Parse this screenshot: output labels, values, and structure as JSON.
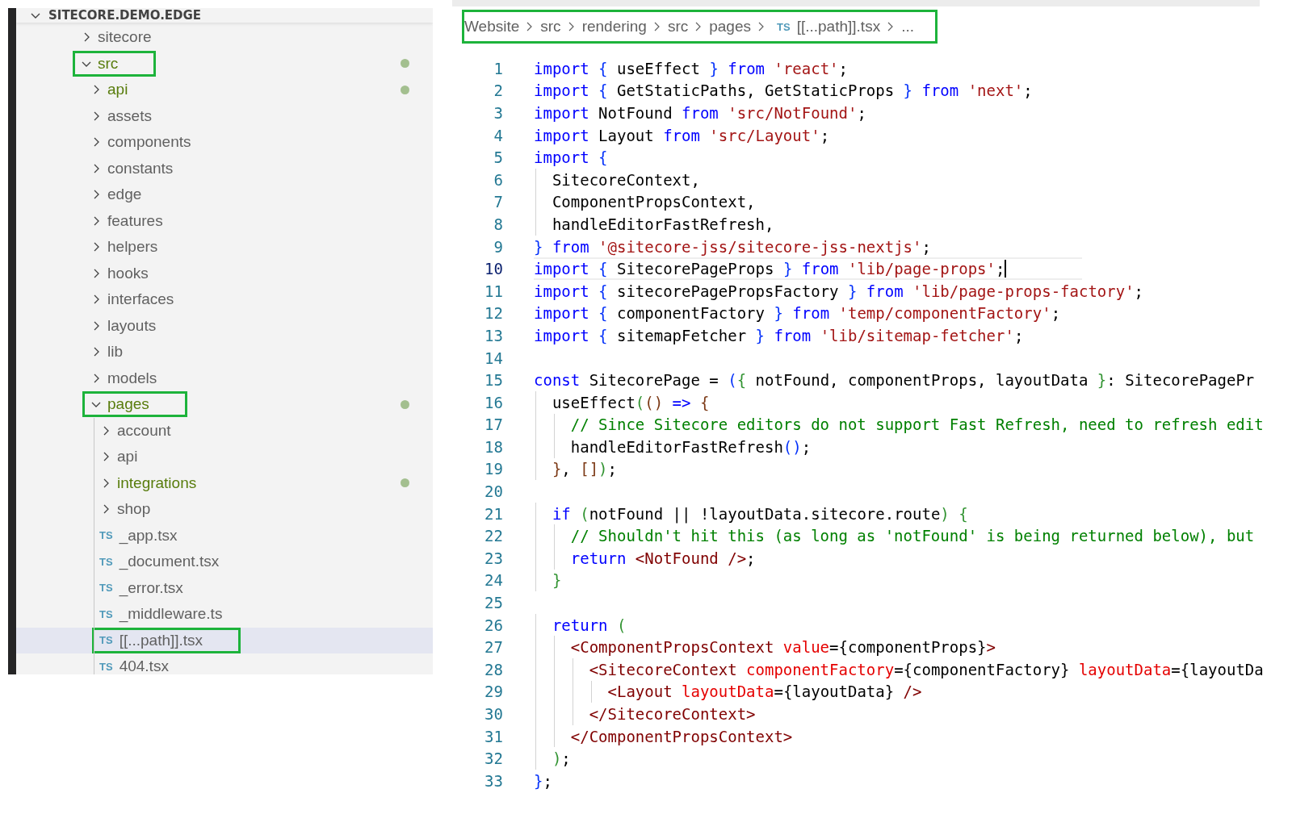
{
  "explorer": {
    "title": "SITECORE.DEMO.EDGE",
    "expanded": true,
    "items": [
      {
        "name": "sitecore",
        "kind": "folder",
        "expanded": false,
        "modified": false,
        "selected": false,
        "highlighted": false
      },
      {
        "name": "src",
        "kind": "folder",
        "expanded": true,
        "modified": true,
        "selected": false,
        "highlighted": true,
        "children": [
          {
            "name": "api",
            "kind": "folder",
            "expanded": false,
            "modified": true,
            "selected": false,
            "highlighted": false
          },
          {
            "name": "assets",
            "kind": "folder",
            "expanded": false,
            "modified": false,
            "selected": false,
            "highlighted": false
          },
          {
            "name": "components",
            "kind": "folder",
            "expanded": false,
            "modified": false,
            "selected": false,
            "highlighted": false
          },
          {
            "name": "constants",
            "kind": "folder",
            "expanded": false,
            "modified": false,
            "selected": false,
            "highlighted": false
          },
          {
            "name": "edge",
            "kind": "folder",
            "expanded": false,
            "modified": false,
            "selected": false,
            "highlighted": false
          },
          {
            "name": "features",
            "kind": "folder",
            "expanded": false,
            "modified": false,
            "selected": false,
            "highlighted": false
          },
          {
            "name": "helpers",
            "kind": "folder",
            "expanded": false,
            "modified": false,
            "selected": false,
            "highlighted": false
          },
          {
            "name": "hooks",
            "kind": "folder",
            "expanded": false,
            "modified": false,
            "selected": false,
            "highlighted": false
          },
          {
            "name": "interfaces",
            "kind": "folder",
            "expanded": false,
            "modified": false,
            "selected": false,
            "highlighted": false
          },
          {
            "name": "layouts",
            "kind": "folder",
            "expanded": false,
            "modified": false,
            "selected": false,
            "highlighted": false
          },
          {
            "name": "lib",
            "kind": "folder",
            "expanded": false,
            "modified": false,
            "selected": false,
            "highlighted": false
          },
          {
            "name": "models",
            "kind": "folder",
            "expanded": false,
            "modified": false,
            "selected": false,
            "highlighted": false
          },
          {
            "name": "pages",
            "kind": "folder",
            "expanded": true,
            "modified": true,
            "selected": false,
            "highlighted": true,
            "children": [
              {
                "name": "account",
                "kind": "folder",
                "expanded": false,
                "modified": false,
                "selected": false,
                "highlighted": false
              },
              {
                "name": "api",
                "kind": "folder",
                "expanded": false,
                "modified": false,
                "selected": false,
                "highlighted": false
              },
              {
                "name": "integrations",
                "kind": "folder",
                "expanded": false,
                "modified": true,
                "selected": false,
                "highlighted": false
              },
              {
                "name": "shop",
                "kind": "folder",
                "expanded": false,
                "modified": false,
                "selected": false,
                "highlighted": false
              },
              {
                "name": "_app.tsx",
                "kind": "file",
                "badge": "TS",
                "modified": false,
                "selected": false,
                "highlighted": false
              },
              {
                "name": "_document.tsx",
                "kind": "file",
                "badge": "TS",
                "modified": false,
                "selected": false,
                "highlighted": false
              },
              {
                "name": "_error.tsx",
                "kind": "file",
                "badge": "TS",
                "modified": false,
                "selected": false,
                "highlighted": false
              },
              {
                "name": "_middleware.ts",
                "kind": "file",
                "badge": "TS",
                "modified": false,
                "selected": false,
                "highlighted": false
              },
              {
                "name": "[[...path]].tsx",
                "kind": "file",
                "badge": "TS",
                "modified": false,
                "selected": true,
                "highlighted": true
              },
              {
                "name": "404.tsx",
                "kind": "file",
                "badge": "TS",
                "modified": false,
                "selected": false,
                "highlighted": false
              }
            ]
          }
        ]
      }
    ]
  },
  "breadcrumb": {
    "highlighted": true,
    "items": [
      {
        "kind": "folder",
        "label": "Website"
      },
      {
        "kind": "folder",
        "label": "src"
      },
      {
        "kind": "folder",
        "label": "rendering"
      },
      {
        "kind": "folder",
        "label": "src"
      },
      {
        "kind": "folder",
        "label": "pages"
      },
      {
        "kind": "file",
        "badge": "TS",
        "label": "[[...path]].tsx"
      },
      {
        "kind": "more",
        "label": "..."
      }
    ]
  },
  "editor": {
    "lines": [
      {
        "number": "1",
        "current": false,
        "tokens": [
          {
            "kind": "kw",
            "text": "import"
          },
          {
            "kind": "b1",
            "text": " {"
          },
          {
            "kind": "id",
            "text": " useEffect "
          },
          {
            "kind": "b1",
            "text": "}"
          },
          {
            "kind": "kw",
            "text": " from"
          },
          {
            "kind": "str",
            "text": " 'react'"
          },
          {
            "kind": "id",
            "text": ";"
          }
        ]
      },
      {
        "number": "2",
        "current": false,
        "tokens": [
          {
            "kind": "kw",
            "text": "import"
          },
          {
            "kind": "b1",
            "text": " {"
          },
          {
            "kind": "id",
            "text": " GetStaticPaths, GetStaticProps "
          },
          {
            "kind": "b1",
            "text": "}"
          },
          {
            "kind": "kw",
            "text": " from"
          },
          {
            "kind": "str",
            "text": " 'next'"
          },
          {
            "kind": "id",
            "text": ";"
          }
        ]
      },
      {
        "number": "3",
        "current": false,
        "tokens": [
          {
            "kind": "kw",
            "text": "import"
          },
          {
            "kind": "id",
            "text": " NotFound "
          },
          {
            "kind": "kw",
            "text": "from"
          },
          {
            "kind": "str",
            "text": " 'src/NotFound'"
          },
          {
            "kind": "id",
            "text": ";"
          }
        ]
      },
      {
        "number": "4",
        "current": false,
        "tokens": [
          {
            "kind": "kw",
            "text": "import"
          },
          {
            "kind": "id",
            "text": " Layout "
          },
          {
            "kind": "kw",
            "text": "from"
          },
          {
            "kind": "str",
            "text": " 'src/Layout'"
          },
          {
            "kind": "id",
            "text": ";"
          }
        ]
      },
      {
        "number": "5",
        "current": false,
        "tokens": [
          {
            "kind": "kw",
            "text": "import"
          },
          {
            "kind": "b1",
            "text": " {"
          }
        ]
      },
      {
        "number": "6",
        "current": false,
        "tokens": [
          {
            "kind": "id",
            "text": "  SitecoreContext,"
          }
        ]
      },
      {
        "number": "7",
        "current": false,
        "tokens": [
          {
            "kind": "id",
            "text": "  ComponentPropsContext,"
          }
        ]
      },
      {
        "number": "8",
        "current": false,
        "tokens": [
          {
            "kind": "id",
            "text": "  handleEditorFastRefresh,"
          }
        ]
      },
      {
        "number": "9",
        "current": false,
        "tokens": [
          {
            "kind": "b1",
            "text": "}"
          },
          {
            "kind": "kw",
            "text": " from"
          },
          {
            "kind": "str",
            "text": " '@sitecore-jss/sitecore-jss-nextjs'"
          },
          {
            "kind": "id",
            "text": ";"
          }
        ]
      },
      {
        "number": "10",
        "current": true,
        "tokens": [
          {
            "kind": "kw",
            "text": "import"
          },
          {
            "kind": "b1",
            "text": " {"
          },
          {
            "kind": "id",
            "text": " SitecorePageProps "
          },
          {
            "kind": "b1",
            "text": "}"
          },
          {
            "kind": "kw",
            "text": " from"
          },
          {
            "kind": "str",
            "text": " 'lib/page-props'"
          },
          {
            "kind": "id",
            "text": ";"
          }
        ]
      },
      {
        "number": "11",
        "current": false,
        "tokens": [
          {
            "kind": "kw",
            "text": "import"
          },
          {
            "kind": "b1",
            "text": " {"
          },
          {
            "kind": "id",
            "text": " sitecorePagePropsFactory "
          },
          {
            "kind": "b1",
            "text": "}"
          },
          {
            "kind": "kw",
            "text": " from"
          },
          {
            "kind": "str",
            "text": " 'lib/page-props-factory'"
          },
          {
            "kind": "id",
            "text": ";"
          }
        ]
      },
      {
        "number": "12",
        "current": false,
        "tokens": [
          {
            "kind": "kw",
            "text": "import"
          },
          {
            "kind": "b1",
            "text": " {"
          },
          {
            "kind": "id",
            "text": " componentFactory "
          },
          {
            "kind": "b1",
            "text": "}"
          },
          {
            "kind": "kw",
            "text": " from"
          },
          {
            "kind": "str",
            "text": " 'temp/componentFactory'"
          },
          {
            "kind": "id",
            "text": ";"
          }
        ]
      },
      {
        "number": "13",
        "current": false,
        "tokens": [
          {
            "kind": "kw",
            "text": "import"
          },
          {
            "kind": "b1",
            "text": " {"
          },
          {
            "kind": "id",
            "text": " sitemapFetcher "
          },
          {
            "kind": "b1",
            "text": "}"
          },
          {
            "kind": "kw",
            "text": " from"
          },
          {
            "kind": "str",
            "text": " 'lib/sitemap-fetcher'"
          },
          {
            "kind": "id",
            "text": ";"
          }
        ]
      },
      {
        "number": "14",
        "current": false
      },
      {
        "number": "15",
        "current": false,
        "tokens": [
          {
            "kind": "kw",
            "text": "const"
          },
          {
            "kind": "id",
            "text": " SitecorePage = "
          },
          {
            "kind": "b1",
            "text": "("
          },
          {
            "kind": "b2",
            "text": "{"
          },
          {
            "kind": "id",
            "text": " notFound, componentProps, layoutData "
          },
          {
            "kind": "b2",
            "text": "}"
          },
          {
            "kind": "id",
            "text": ": SitecorePagePr"
          }
        ]
      },
      {
        "number": "16",
        "current": false,
        "tokens": [
          {
            "kind": "id",
            "text": "  useEffect"
          },
          {
            "kind": "b2",
            "text": "("
          },
          {
            "kind": "b3",
            "text": "()"
          },
          {
            "kind": "kw",
            "text": " =>"
          },
          {
            "kind": "b3",
            "text": " {"
          }
        ]
      },
      {
        "number": "17",
        "current": false,
        "tokens": [
          {
            "kind": "cmt",
            "text": "    // Since Sitecore editors do not support Fast Refresh, need to refresh edit"
          }
        ]
      },
      {
        "number": "18",
        "current": false,
        "tokens": [
          {
            "kind": "id",
            "text": "    handleEditorFastRefresh"
          },
          {
            "kind": "b1",
            "text": "()"
          },
          {
            "kind": "id",
            "text": ";"
          }
        ]
      },
      {
        "number": "19",
        "current": false,
        "tokens": [
          {
            "kind": "b3",
            "text": "  }"
          },
          {
            "kind": "id",
            "text": ","
          },
          {
            "kind": "b3",
            "text": " []"
          },
          {
            "kind": "b2",
            "text": ")"
          },
          {
            "kind": "id",
            "text": ";"
          }
        ]
      },
      {
        "number": "20",
        "current": false
      },
      {
        "number": "21",
        "current": false,
        "tokens": [
          {
            "kind": "kw",
            "text": "  if"
          },
          {
            "kind": "b2",
            "text": " ("
          },
          {
            "kind": "id",
            "text": "notFound || !layoutData.sitecore.route"
          },
          {
            "kind": "b2",
            "text": ")"
          },
          {
            "kind": "b2",
            "text": " {"
          }
        ]
      },
      {
        "number": "22",
        "current": false,
        "tokens": [
          {
            "kind": "cmt",
            "text": "    // Shouldn't hit this (as long as 'notFound' is being returned below), but"
          }
        ]
      },
      {
        "number": "23",
        "current": false,
        "tokens": [
          {
            "kind": "kw",
            "text": "    return"
          },
          {
            "kind": "tag",
            "text": " <NotFound />"
          },
          {
            "kind": "id",
            "text": ";"
          }
        ]
      },
      {
        "number": "24",
        "current": false,
        "tokens": [
          {
            "kind": "b2",
            "text": "  }"
          }
        ]
      },
      {
        "number": "25",
        "current": false
      },
      {
        "number": "26",
        "current": false,
        "tokens": [
          {
            "kind": "kw",
            "text": "  return"
          },
          {
            "kind": "b2",
            "text": " ("
          }
        ]
      },
      {
        "number": "27",
        "current": false,
        "tokens": [
          {
            "kind": "tag",
            "text": "    <ComponentPropsContext"
          },
          {
            "kind": "attr",
            "text": " value"
          },
          {
            "kind": "id",
            "text": "={componentProps}"
          },
          {
            "kind": "tag",
            "text": ">"
          }
        ]
      },
      {
        "number": "28",
        "current": false,
        "tokens": [
          {
            "kind": "tag",
            "text": "      <SitecoreContext"
          },
          {
            "kind": "attr",
            "text": " componentFactory"
          },
          {
            "kind": "id",
            "text": "={componentFactory}"
          },
          {
            "kind": "attr",
            "text": " layoutData"
          },
          {
            "kind": "id",
            "text": "={layoutDa"
          }
        ]
      },
      {
        "number": "29",
        "current": false,
        "tokens": [
          {
            "kind": "tag",
            "text": "        <Layout"
          },
          {
            "kind": "attr",
            "text": " layoutData"
          },
          {
            "kind": "id",
            "text": "={layoutData}"
          },
          {
            "kind": "tag",
            "text": " />"
          }
        ]
      },
      {
        "number": "30",
        "current": false,
        "tokens": [
          {
            "kind": "tag",
            "text": "      </SitecoreContext>"
          }
        ]
      },
      {
        "number": "31",
        "current": false,
        "tokens": [
          {
            "kind": "tag",
            "text": "    </ComponentPropsContext>"
          }
        ]
      },
      {
        "number": "32",
        "current": false,
        "tokens": [
          {
            "kind": "b2",
            "text": "  )"
          },
          {
            "kind": "id",
            "text": ";"
          }
        ]
      },
      {
        "number": "33",
        "current": false,
        "tokens": [
          {
            "kind": "b1",
            "text": "}"
          },
          {
            "kind": "id",
            "text": ";"
          }
        ]
      }
    ]
  }
}
